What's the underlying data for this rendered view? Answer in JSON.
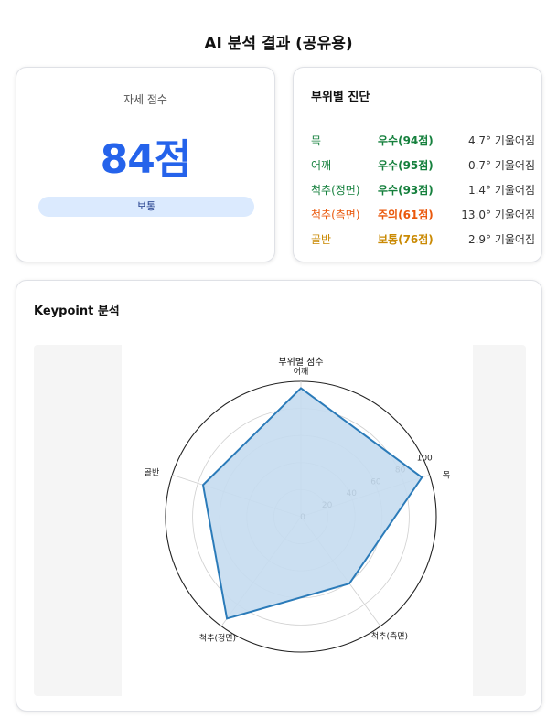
{
  "page_title": "AI 분석 결과 (공유용)",
  "score_card": {
    "label": "자세 점수",
    "score": "84점",
    "grade": "보통"
  },
  "diagnosis": {
    "title": "부위별 진단",
    "rows": [
      {
        "part": "목",
        "status": "우수(94점)",
        "tilt": "4.7° 기울어짐",
        "color": "#15803d"
      },
      {
        "part": "어깨",
        "status": "우수(95점)",
        "tilt": "0.7° 기울어짐",
        "color": "#15803d"
      },
      {
        "part": "척추(정면)",
        "status": "우수(93점)",
        "tilt": "1.4° 기울어짐",
        "color": "#15803d"
      },
      {
        "part": "척추(측면)",
        "status": "주의(61점)",
        "tilt": "13.0° 기울어짐",
        "color": "#ea580c"
      },
      {
        "part": "골반",
        "status": "보통(76점)",
        "tilt": "2.9° 기울어짐",
        "color": "#ca8a04"
      }
    ]
  },
  "keypoint": {
    "title": "Keypoint 분석"
  },
  "chart_data": {
    "type": "radar",
    "title": "부위별 점수",
    "categories": [
      "어깨",
      "목",
      "척추(측면)",
      "척추(정면)",
      "골반"
    ],
    "series": [
      {
        "values": [
          95,
          94,
          61,
          93,
          76
        ]
      }
    ],
    "rlim": [
      0,
      100
    ],
    "rticks": [
      0,
      20,
      40,
      60,
      80,
      100
    ],
    "line_color": "#2b7bb9",
    "fill_color": "#c5dcef"
  }
}
